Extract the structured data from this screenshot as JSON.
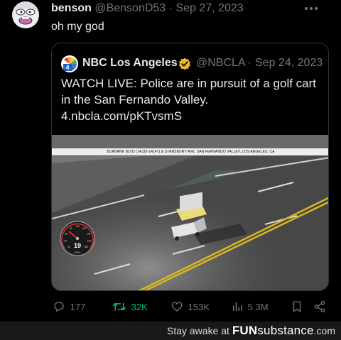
{
  "tweet": {
    "display_name": "benson",
    "handle": "@BensonD53",
    "separator": "·",
    "date": "Sep 27, 2023",
    "text": "oh my god",
    "more_icon": "more-icon"
  },
  "quote": {
    "display_name": "NBC Los Angeles",
    "verified_icon": "verified-badge-icon",
    "handle": "@NBCLA",
    "separator": "·",
    "date": "Sep 24, 2023",
    "text": "WATCH LIVE: Police are in pursuit of a golf cart in the San Fernando Valley.",
    "link": "4.nbcla.com/pKTvsmS",
    "media": {
      "banner": "BURBANK BLVD (14130-14147) & STANSBURY AVE, SAN FERNANDO VALLEY, LOS ANGELES, CA",
      "speed_value": "19",
      "speed_unit": "MPH",
      "gauge_ticks": [
        "20",
        "40",
        "60",
        "80",
        "100",
        "120",
        "140",
        "160",
        "180"
      ]
    }
  },
  "actions": {
    "replies": "177",
    "retweets": "32K",
    "likes": "153K",
    "views": "5.3M"
  },
  "watermark": {
    "prefix": "Stay awake at ",
    "brand_bold": "FUN",
    "brand_rest": "substance",
    "suffix": ".com"
  },
  "colors": {
    "background": "#000000",
    "text": "#e7e9ea",
    "muted": "#71767b",
    "retweet_green": "#00ba7c",
    "border": "#2f3336",
    "verified_gold": "#e8b829"
  }
}
